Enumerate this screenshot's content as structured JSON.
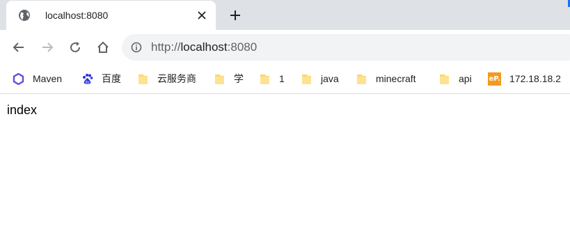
{
  "tab": {
    "title": "localhost:8080",
    "favicon": "globe-icon",
    "close_icon": "close-icon"
  },
  "new_tab_icon": "plus-icon",
  "toolbar": {
    "back_icon": "back-arrow-icon",
    "forward_icon": "forward-arrow-icon",
    "reload_icon": "reload-icon",
    "home_icon": "home-icon"
  },
  "omnibox": {
    "info_icon": "info-icon",
    "url_scheme": "http://",
    "url_host": "localhost",
    "url_port": ":8080"
  },
  "bookmarks": [
    {
      "label": "Maven",
      "icon": "maven-icon"
    },
    {
      "label": "百度",
      "icon": "baidu-icon"
    },
    {
      "label": "云服务商",
      "icon": "folder-icon"
    },
    {
      "label": "学",
      "icon": "folder-icon"
    },
    {
      "label": "1",
      "icon": "folder-icon"
    },
    {
      "label": "java",
      "icon": "folder-icon"
    },
    {
      "label": "minecraft",
      "icon": "folder-icon"
    },
    {
      "label": "api",
      "icon": "folder-icon"
    },
    {
      "label": "172.18.18.2",
      "icon": "ep-icon",
      "icon_text": "eP."
    }
  ],
  "page": {
    "body_text": "index"
  },
  "colors": {
    "tabstrip": "#dee1e6",
    "omnibox": "#f1f3f4",
    "folder": "#fbd86b",
    "maven": "#6b4bd8",
    "baidu": "#2932e1",
    "ep": "#f39a1e",
    "accent": "#1a73e8"
  }
}
